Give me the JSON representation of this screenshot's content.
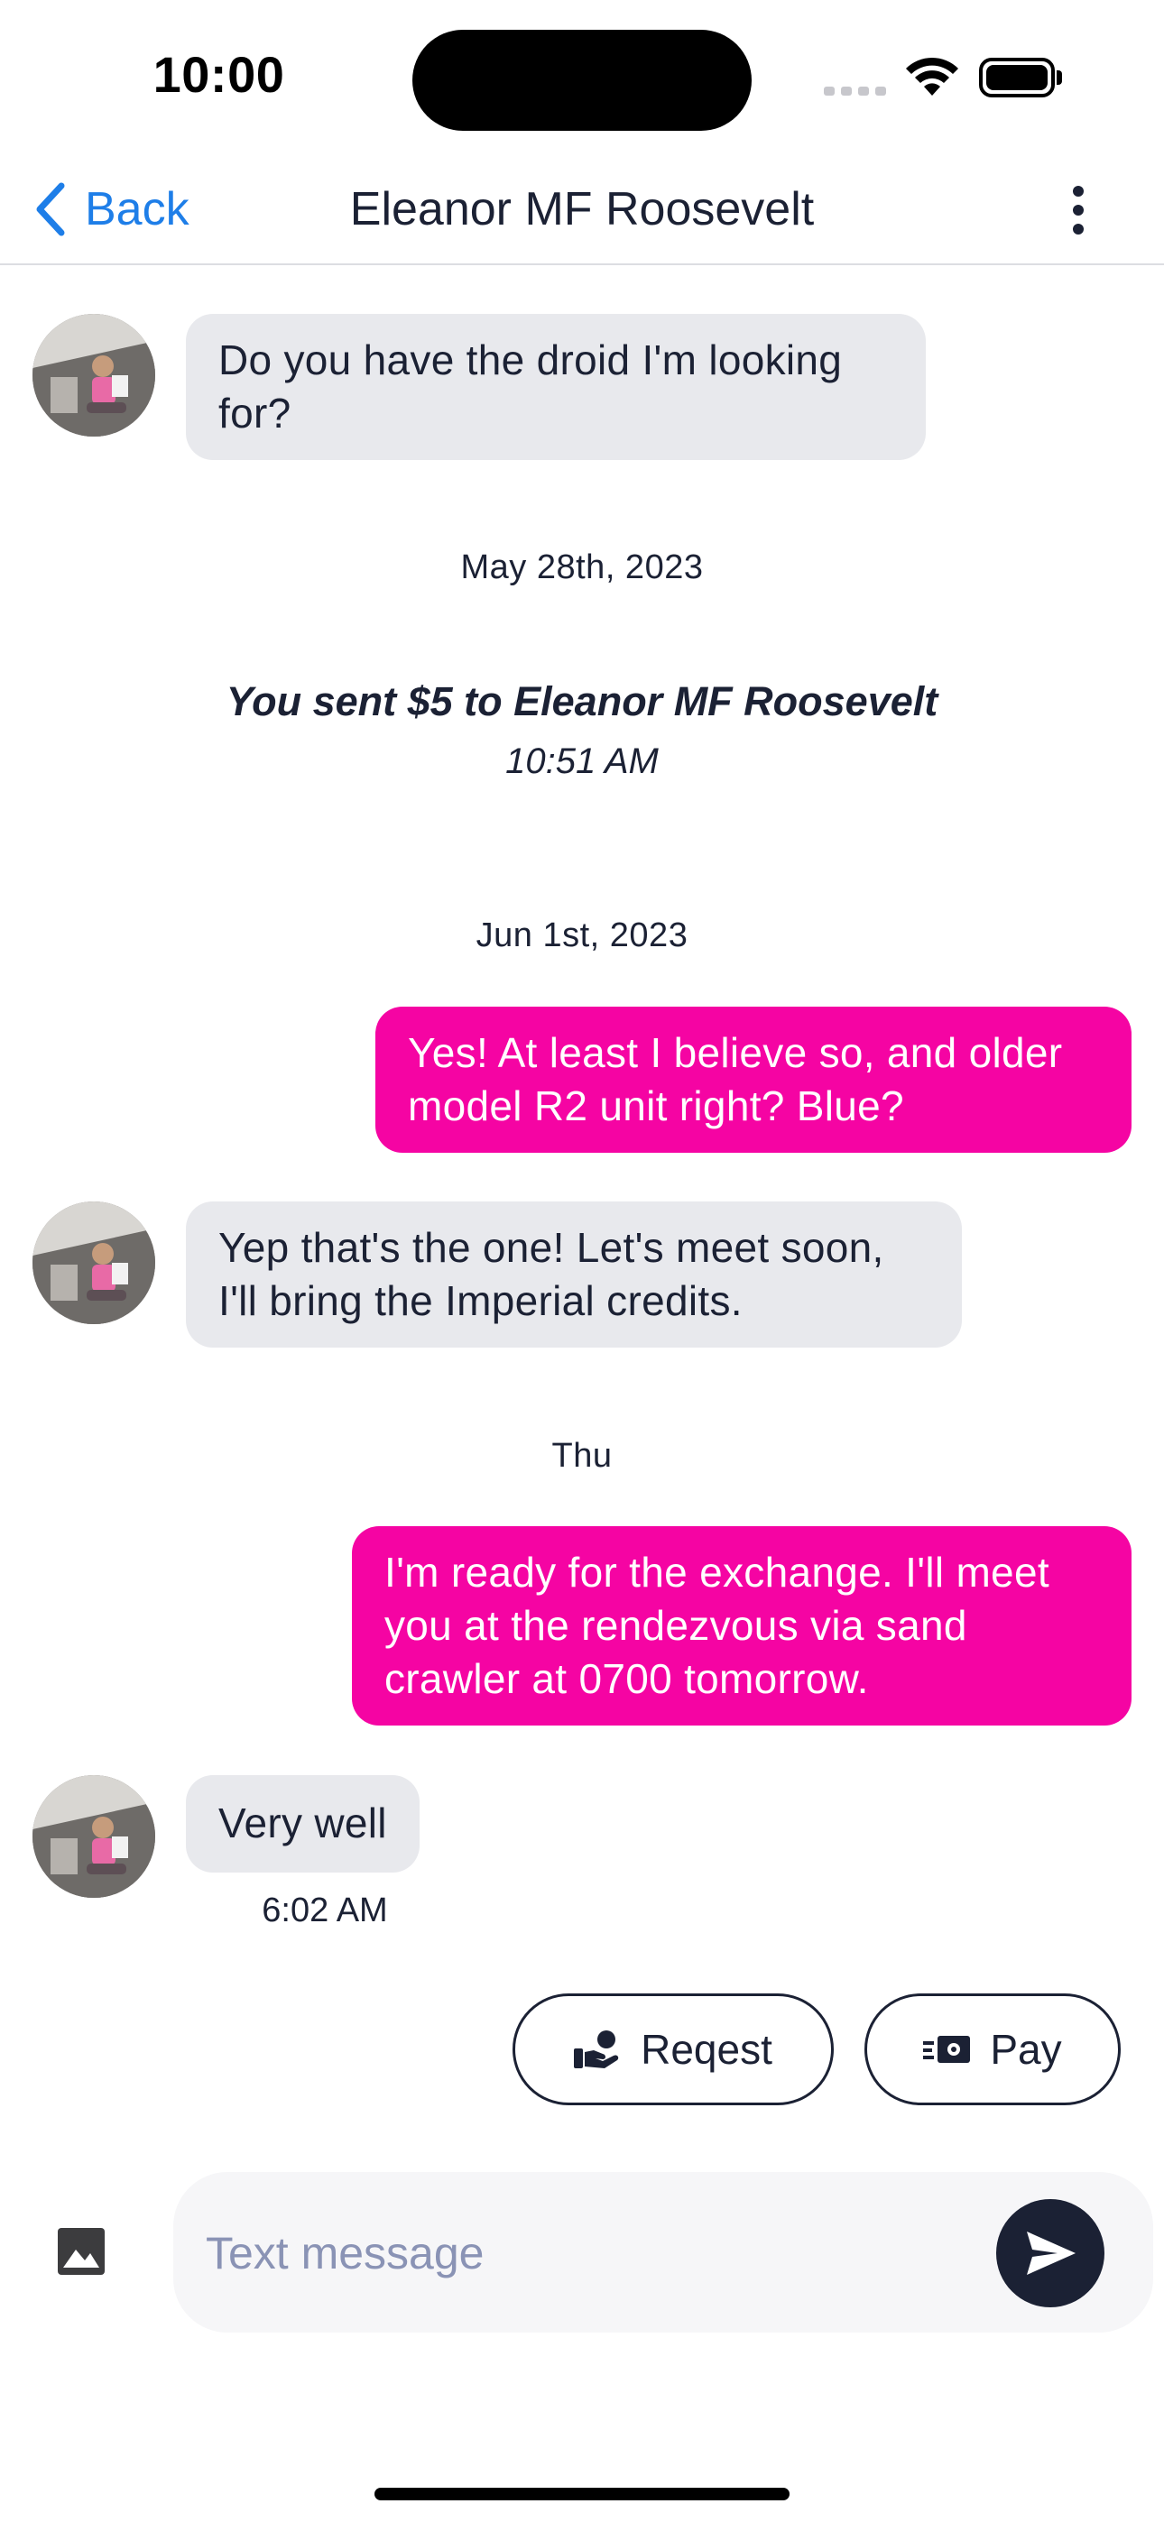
{
  "status_bar": {
    "time": "10:00"
  },
  "header": {
    "back_label": "Back",
    "title": "Eleanor MF Roosevelt"
  },
  "conversation": {
    "messages": [
      {
        "direction": "incoming",
        "text": "Do you have the droid I'm looking for?"
      },
      {
        "direction": "outgoing",
        "text": "Yes! At least I believe so, and older model R2 unit right? Blue?"
      },
      {
        "direction": "incoming",
        "text": "Yep that's the one! Let's meet soon, I'll bring the Imperial credits."
      },
      {
        "direction": "outgoing",
        "text": "I'm ready for the exchange. I'll meet you at the rendezvous via sand crawler at 0700 tomorrow."
      },
      {
        "direction": "incoming",
        "text": "Very well",
        "time": "6:02 AM"
      }
    ],
    "date_separators": [
      "May 28th, 2023",
      "Jun 1st, 2023",
      "Thu"
    ],
    "payment_event": {
      "text": "You sent $5 to Eleanor MF Roosevelt",
      "time": "10:51 AM"
    }
  },
  "actions": {
    "request_label": "Reqest",
    "pay_label": "Pay"
  },
  "composer": {
    "placeholder": "Text message"
  },
  "colors": {
    "accent_blue": "#1e7ee8",
    "outgoing_bubble": "#f504a3",
    "incoming_bubble": "#e8e9ed",
    "dark_navy": "#1b2134"
  },
  "icons": {
    "back": "chevron-left-icon",
    "more": "more-vertical-icon",
    "request": "hand-receive-money-icon",
    "pay": "cash-send-icon",
    "image": "image-icon",
    "send": "send-icon"
  }
}
